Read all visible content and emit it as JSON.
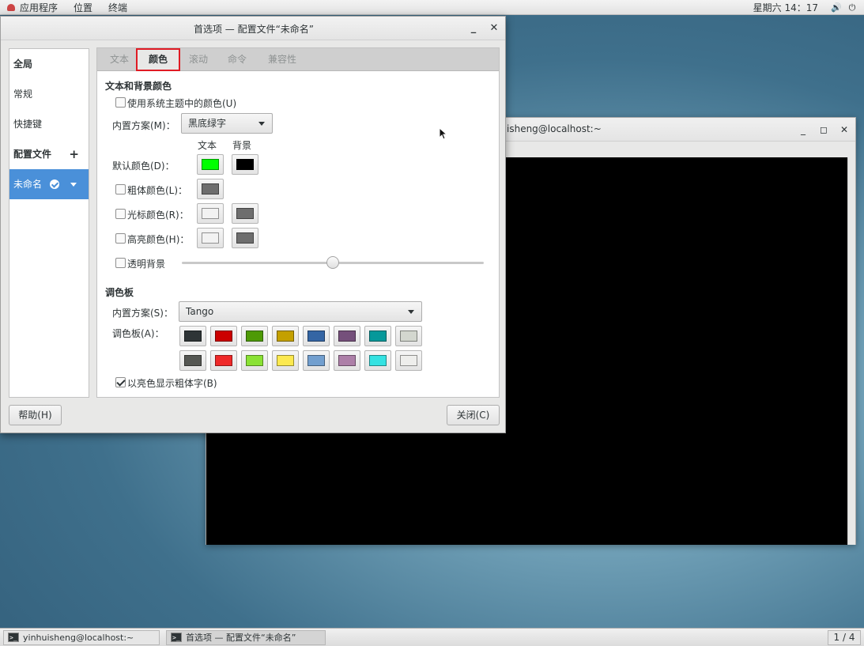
{
  "topbar": {
    "apps_label": "应用程序",
    "places_label": "位置",
    "terminal_label": "终端",
    "clock": "星期六 14：17"
  },
  "terminal_window": {
    "title": "isheng@localhost:~"
  },
  "dialog": {
    "title": "首选项 — 配置文件“未命名”",
    "sidebar": {
      "global": "全局",
      "general": "常规",
      "shortcuts": "快捷键",
      "profiles": "配置文件",
      "profile_unnamed": "未命名"
    },
    "tabs": [
      "文本",
      "颜色",
      "滚动",
      "命令",
      "兼容性"
    ],
    "colors": {
      "section_title": "文本和背景颜色",
      "use_system_theme": "使用系统主题中的颜色(U)",
      "builtin_scheme_label": "内置方案(M)：",
      "builtin_scheme_value": "黑底绿字",
      "col_text": "文本",
      "col_background": "背景",
      "default_color_label": "默认颜色(D)：",
      "bold_color_label": "粗体颜色(L)：",
      "cursor_color_label": "光标颜色(R)：",
      "highlight_color_label": "高亮颜色(H)：",
      "transparent_bg_label": "透明背景",
      "transparency_level": 0.5,
      "default_text_color": "#00ff00",
      "default_bg_color": "#000000",
      "bold_color": "#6e6e6e",
      "cursor_text_color": "#f2f2f2",
      "cursor_bg_color": "#6e6e6e",
      "highlight_text_color": "#f2f2f2",
      "highlight_bg_color": "#6e6e6e"
    },
    "palette": {
      "section_title": "调色板",
      "builtin_scheme_label": "内置方案(S)：",
      "builtin_scheme_value": "Tango",
      "palette_label": "调色板(A)：",
      "row1": [
        "#2e3436",
        "#cc0000",
        "#4e9a06",
        "#c4a000",
        "#3465a4",
        "#75507b",
        "#06989a",
        "#d3d7cf"
      ],
      "row2": [
        "#555753",
        "#ef2929",
        "#8ae234",
        "#fce94f",
        "#729fcf",
        "#ad7fa8",
        "#34e2e2",
        "#eeeeec"
      ],
      "bold_bright_label": "以亮色显示粗体字(B)",
      "bold_bright_checked": true
    },
    "help_button": "帮助(H)",
    "close_button": "关闭(C)"
  },
  "taskbar": {
    "task1": "yinhuisheng@localhost:~",
    "task2": "首选项 — 配置文件“未命名”",
    "pager": "1 / 4"
  }
}
